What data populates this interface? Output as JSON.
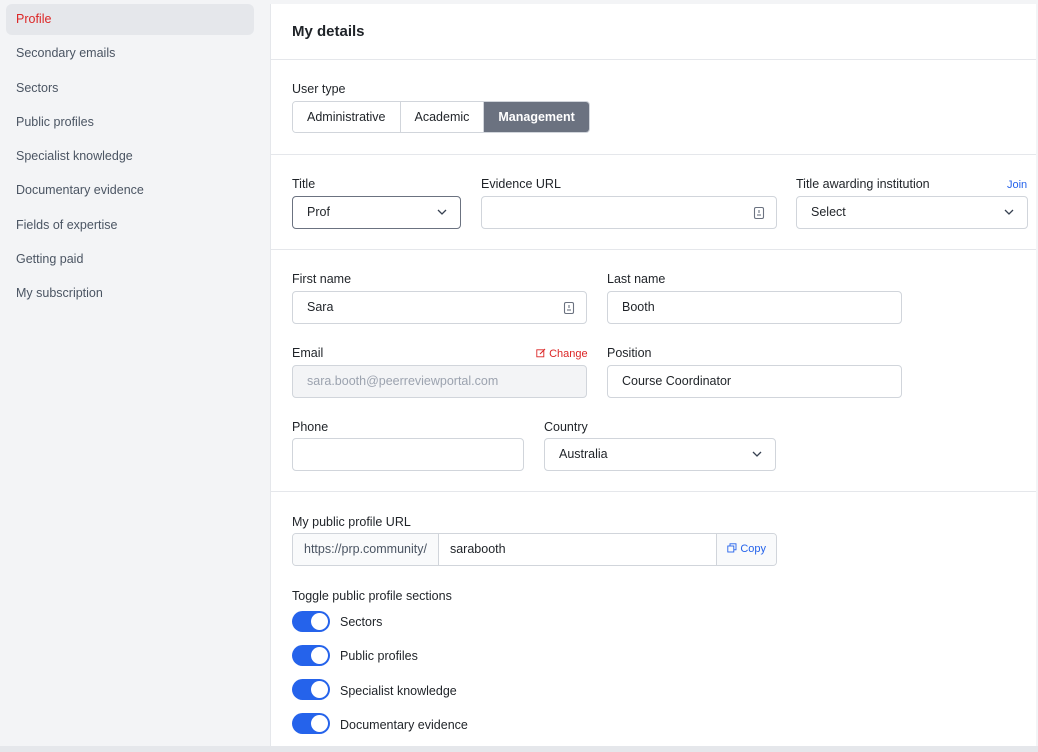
{
  "sidebar": {
    "items": [
      {
        "label": "Profile",
        "active": true
      },
      {
        "label": "Secondary emails"
      },
      {
        "label": "Sectors"
      },
      {
        "label": "Public profiles"
      },
      {
        "label": "Specialist knowledge"
      },
      {
        "label": "Documentary evidence"
      },
      {
        "label": "Fields of expertise"
      },
      {
        "label": "Getting paid"
      },
      {
        "label": "My subscription"
      }
    ]
  },
  "main": {
    "title": "My details",
    "user_type": {
      "label": "User type",
      "options": [
        "Administrative",
        "Academic",
        "Management"
      ],
      "selected": "Management"
    },
    "title_field": {
      "label": "Title",
      "value": "Prof"
    },
    "evidence_url": {
      "label": "Evidence URL",
      "value": ""
    },
    "institution": {
      "label": "Title awarding institution",
      "value": "Select",
      "join_label": "Join"
    },
    "first_name": {
      "label": "First name",
      "value": "Sara"
    },
    "last_name": {
      "label": "Last name",
      "value": "Booth"
    },
    "email": {
      "label": "Email",
      "value": "sara.booth@peerreviewportal.com",
      "change_label": "Change"
    },
    "position": {
      "label": "Position",
      "value": "Course Coordinator"
    },
    "phone": {
      "label": "Phone",
      "value": ""
    },
    "country": {
      "label": "Country",
      "value": "Australia"
    },
    "profile_url": {
      "label": "My public profile URL",
      "prefix": "https://prp.community/",
      "value": "sarabooth",
      "copy_label": "Copy"
    },
    "toggles": {
      "label": "Toggle public profile sections",
      "items": [
        {
          "label": "Sectors",
          "on": true
        },
        {
          "label": "Public profiles",
          "on": true
        },
        {
          "label": "Specialist knowledge",
          "on": true
        },
        {
          "label": "Documentary evidence",
          "on": true
        }
      ]
    }
  },
  "colors": {
    "accent_red": "#dc2626",
    "accent_blue": "#2563eb",
    "segment_active": "#6b7280"
  }
}
